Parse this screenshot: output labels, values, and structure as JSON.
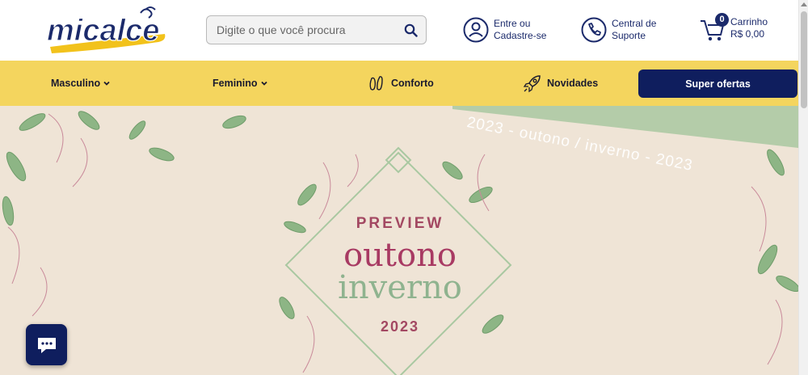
{
  "header": {
    "logo_text": "micalce",
    "search": {
      "placeholder": "Digite o que você procura",
      "value": ""
    },
    "account": {
      "line1": "Entre ou",
      "line2": "Cadastre-se",
      "icon": "user-icon"
    },
    "support": {
      "line1": "Central de",
      "line2": "Suporte",
      "icon": "phone-icon"
    },
    "cart": {
      "label": "Carrinho",
      "total": "R$ 0,00",
      "count": "0",
      "icon": "cart-icon"
    }
  },
  "nav": {
    "items": [
      {
        "label": "Masculino",
        "icon": "chevron-down-icon"
      },
      {
        "label": "Feminino",
        "icon": "chevron-down-icon"
      },
      {
        "label": "Conforto",
        "icon": "footprint-icon"
      },
      {
        "label": "Novidades",
        "icon": "rocket-icon"
      }
    ],
    "offers_label": "Super ofertas"
  },
  "banner": {
    "ribbon": "2023 - outono / inverno - 2023",
    "kicker": "PREVIEW",
    "title_line1": "outono",
    "title_line2": "inverno",
    "year": "2023"
  },
  "colors": {
    "brand_navy": "#0f1e5e",
    "nav_yellow": "#f4d55e",
    "banner_bg": "#efe4d6",
    "accent_rose": "#a83a63",
    "accent_sage": "#8fb38f"
  }
}
